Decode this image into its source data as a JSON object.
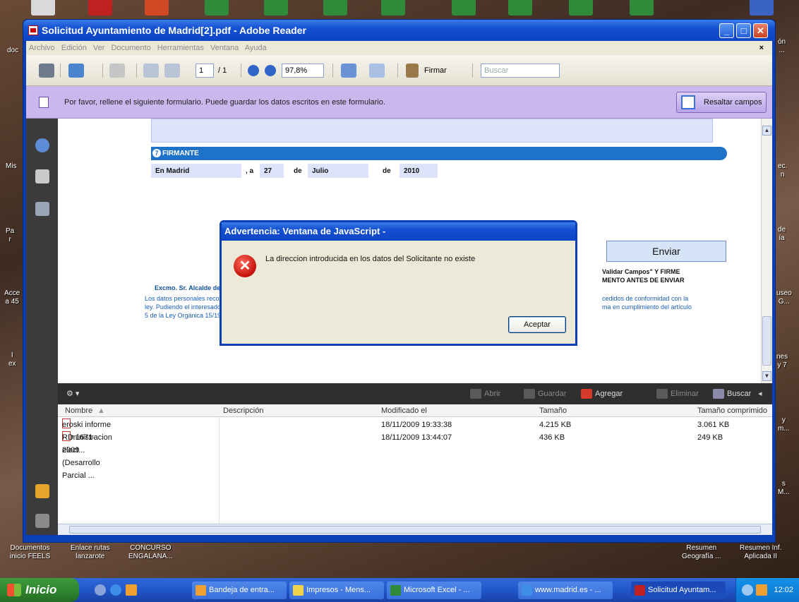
{
  "desktop": {
    "left_icons": [
      {
        "label": "doc"
      },
      {
        "label": "Mis"
      },
      {
        "label": "Pa\nr"
      },
      {
        "label": "Acce\na 45"
      },
      {
        "label": "I\nex"
      }
    ],
    "right_icons": [
      {
        "label": "ón\n..."
      },
      {
        "label": "ec.\nn"
      },
      {
        "label": "de\nía"
      },
      {
        "label": "useo\nG..."
      },
      {
        "label": "nes\ny 7"
      },
      {
        "label": "y\nm..."
      },
      {
        "label": "s\nM..."
      }
    ],
    "bottom_icons": [
      {
        "label": "Documentos\ninicio FEELS"
      },
      {
        "label": "Enlace rutas\nlanzarote"
      },
      {
        "label": "CONCURSO\nENGALANA..."
      },
      {
        "label": "Resumen\nGeografía ..."
      },
      {
        "label": "Resumen Inf.\nAplicada II"
      }
    ]
  },
  "window": {
    "title": "Solicitud Ayuntamiento de Madrid[2].pdf - Adobe Reader",
    "menu": [
      "Archivo",
      "Edición",
      "Ver",
      "Documento",
      "Herramientas",
      "Ventana",
      "Ayuda"
    ],
    "menu_close": "×"
  },
  "toolbar": {
    "page_current": "1",
    "page_total": "/ 1",
    "zoom": "97,8%",
    "sign_label": "Firmar",
    "search_placeholder": "Buscar"
  },
  "formbar": {
    "message": "Por favor, rellene el siguiente formulario. Puede guardar los datos escritos en este formulario.",
    "highlight_label": "Resaltar campos"
  },
  "document": {
    "section_number": "7",
    "section_title": "FIRMANTE",
    "place_label": "En Madrid",
    "day_prefix": ", a",
    "day": "27",
    "month_prefix": "de",
    "month": "Julio",
    "year_prefix": "de",
    "year": "2010",
    "send_button": "Enviar",
    "validate_line1": "Validar Campos\" Y FIRME",
    "validate_line2": "MENTO ANTES DE ENVIAR",
    "alcalde": "Excmo. Sr. Alcalde de Ma",
    "legal_left": [
      "Los datos personales reco",
      "ley. Pudiendo el interesado",
      "5 de la Ley Orgánica 15/19"
    ],
    "legal_right": [
      "cedidos de conformidad con la",
      "ma en cumplimiento del artículo"
    ]
  },
  "attachments_bar": {
    "open": "Abrir",
    "save": "Guardar",
    "add": "Agregar",
    "delete": "Eliminar",
    "search": "Buscar"
  },
  "file_table": {
    "columns": [
      "Nombre",
      "Descripción",
      "Modificado el",
      "Tamaño",
      "Tamaño comprimido"
    ],
    "rows": [
      {
        "name": "eroski informe administracion elect...",
        "desc": "",
        "modified": "18/11/2009 19:33:38",
        "size": "4.215 KB",
        "compressed": "3.061 KB"
      },
      {
        "name": "RD 1671-2009 (Desarrollo Parcial ...",
        "desc": "",
        "modified": "18/11/2009 13:44:07",
        "size": "436 KB",
        "compressed": "249 KB"
      }
    ]
  },
  "dialog": {
    "title": "Advertencia: Ventana de JavaScript -",
    "message": "La direccion introducida en los datos del Solicitante no existe",
    "ok": "Aceptar",
    "icon_glyph": "✕"
  },
  "taskbar": {
    "start": "Inicio",
    "buttons": [
      {
        "label": "Bandeja de entra..."
      },
      {
        "label": "Impresos - Mens..."
      },
      {
        "label": "Microsoft Excel - ..."
      },
      {
        "label": "www.madrid.es - ..."
      },
      {
        "label": "Solicitud Ayuntam..."
      }
    ],
    "clock": "12:02"
  }
}
